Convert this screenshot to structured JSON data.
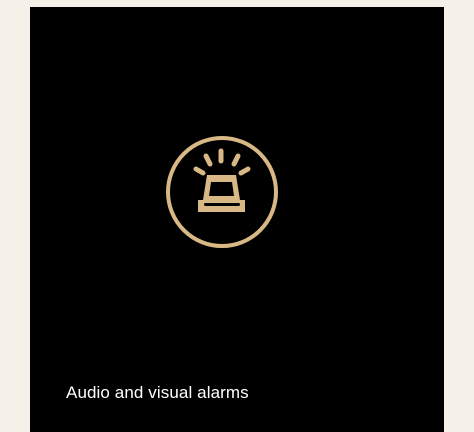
{
  "feature_card": {
    "caption": "Audio and visual alarms",
    "icon": "siren-alarm-icon",
    "colors": {
      "background": "#000000",
      "page_background": "#f6f1e8",
      "icon": "#d8b985",
      "caption": "#ffffff"
    }
  }
}
